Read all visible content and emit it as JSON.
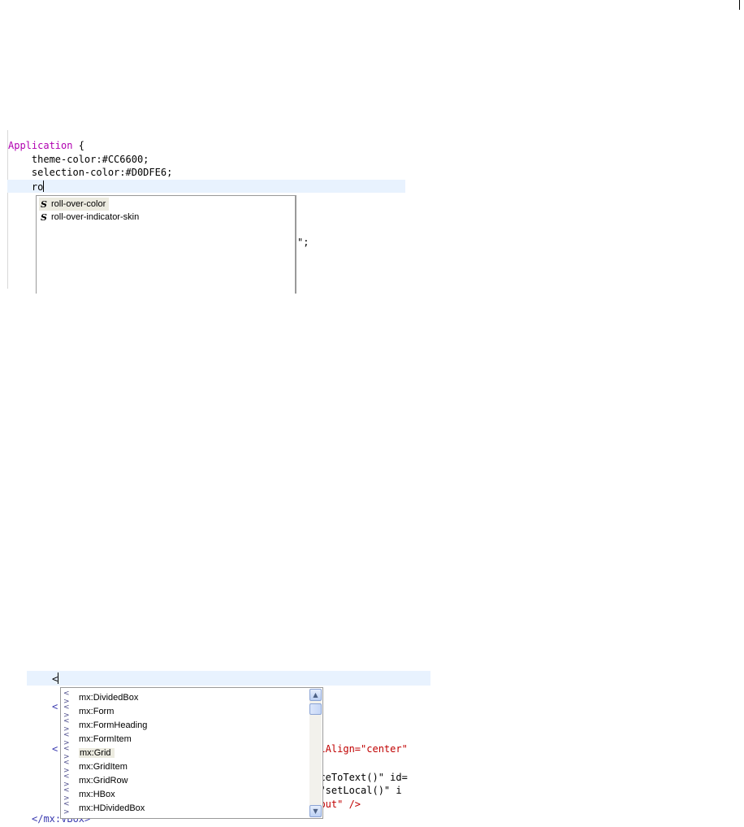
{
  "css_snippet": {
    "lines": [
      {
        "selector": "Application",
        "rest": " {"
      },
      {
        "text": "    theme-color:#CC6600;"
      },
      {
        "text": "    selection-color:#D0DFE6;"
      },
      {
        "text": "    ro"
      }
    ],
    "behind_popup_text": "\";",
    "autocomplete": {
      "items": [
        {
          "icon": "style-property-icon",
          "glyph": "S",
          "label": "roll-over-color",
          "selected": true
        },
        {
          "icon": "style-property-icon",
          "glyph": "S",
          "label": "roll-over-indicator-skin",
          "selected": false
        }
      ]
    }
  },
  "mxml_snippet": {
    "typed": "<",
    "behind_lines": [
      {
        "text": "<"
      },
      {
        "text": "<"
      },
      {
        "text": "talAlign=\"center\""
      },
      {
        "text": "raceToText()\" id="
      },
      {
        "text": "k=\"setLocal()\" i"
      },
      {
        "text": "utput\" />"
      },
      {
        "text": "</mx:VBox>"
      }
    ],
    "autocomplete": {
      "items": [
        {
          "icon": "tag-icon",
          "glyph": "< >",
          "label": "mx:DividedBox",
          "selected": false
        },
        {
          "icon": "tag-icon",
          "glyph": "< >",
          "label": "mx:Form",
          "selected": false
        },
        {
          "icon": "tag-icon",
          "glyph": "< >",
          "label": "mx:FormHeading",
          "selected": false
        },
        {
          "icon": "tag-icon",
          "glyph": "< >",
          "label": "mx:FormItem",
          "selected": false
        },
        {
          "icon": "tag-icon",
          "glyph": "< >",
          "label": "mx:Grid",
          "selected": true
        },
        {
          "icon": "tag-icon",
          "glyph": "< >",
          "label": "mx:GridItem",
          "selected": false
        },
        {
          "icon": "tag-icon",
          "glyph": "< >",
          "label": "mx:GridRow",
          "selected": false
        },
        {
          "icon": "tag-icon",
          "glyph": "< >",
          "label": "mx:HBox",
          "selected": false
        },
        {
          "icon": "tag-icon",
          "glyph": "< >",
          "label": "mx:HDividedBox",
          "selected": false
        }
      ],
      "scroll_up": "▲",
      "scroll_down": "▼"
    }
  },
  "colors": {
    "keyword": "#b000b0",
    "current_line": "#e8f2fe",
    "selection": "#ecebe0",
    "string": "#c00000"
  }
}
